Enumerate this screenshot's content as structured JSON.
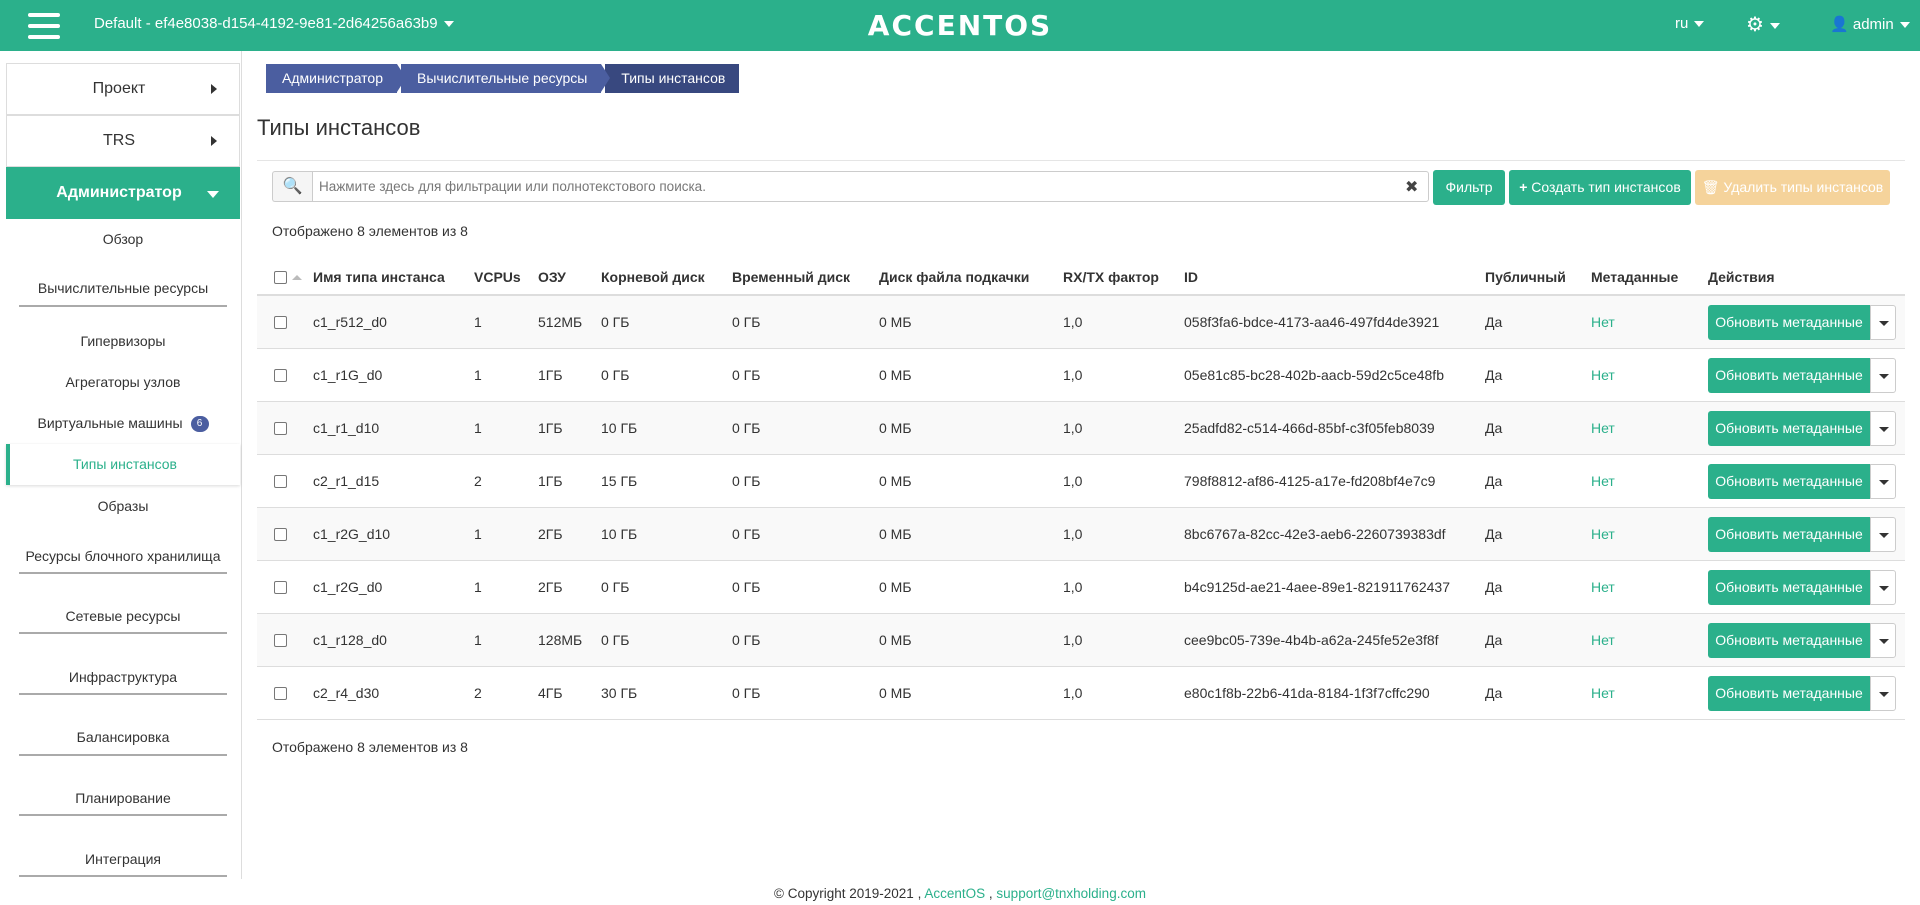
{
  "header": {
    "project": "Default - ef4e8038-d154-4192-9e81-2d64256a63b9",
    "logo": "ACCENTOS",
    "lang": "ru",
    "user": "admin"
  },
  "sidebar": {
    "project": "Проект",
    "trs": "TRS",
    "admin": "Администратор",
    "items": {
      "overview": "Обзор",
      "compute": "Вычислительные ресурсы",
      "hypervisors": "Гипервизоры",
      "aggregates": "Агрегаторы узлов",
      "vms": "Виртуальные машины",
      "vms_count": "6",
      "flavors": "Типы инстансов",
      "images": "Образы",
      "block": "Ресурсы блочного хранилища",
      "network": "Сетевые ресурсы",
      "infra": "Инфраструктура",
      "balancing": "Балансировка",
      "planning": "Планирование",
      "integration": "Интеграция"
    }
  },
  "breadcrumb": [
    "Администратор",
    "Вычислительные ресурсы",
    "Типы инстансов"
  ],
  "page_title": "Типы инстансов",
  "filter": {
    "placeholder": "Нажмите здесь для фильтрации или полнотекстового поиска.",
    "filter_btn": "Фильтр",
    "create_btn": "Создать тип инстансов",
    "delete_btn": "Удалить типы инстансов"
  },
  "count_text": "Отображено 8 элементов из 8",
  "table": {
    "headers": {
      "name": "Имя типа инстанса",
      "vcpus": "VCPUs",
      "ram": "ОЗУ",
      "root": "Корневой диск",
      "ephemeral": "Временный диск",
      "swap": "Диск файла подкачки",
      "rxtx": "RX/TX фактор",
      "id": "ID",
      "public": "Публичный",
      "metadata": "Метаданные",
      "actions": "Действия"
    },
    "action_label": "Обновить метаданные",
    "rows": [
      {
        "name": "c1_r512_d0",
        "vcpus": "1",
        "ram": "512МБ",
        "root": "0 ГБ",
        "ephemeral": "0 ГБ",
        "swap": "0 МБ",
        "rxtx": "1,0",
        "id": "058f3fa6-bdce-4173-aa46-497fd4de3921",
        "public": "Да",
        "metadata": "Нет"
      },
      {
        "name": "c1_r1G_d0",
        "vcpus": "1",
        "ram": "1ГБ",
        "root": "0 ГБ",
        "ephemeral": "0 ГБ",
        "swap": "0 МБ",
        "rxtx": "1,0",
        "id": "05e81c85-bc28-402b-aacb-59d2c5ce48fb",
        "public": "Да",
        "metadata": "Нет"
      },
      {
        "name": "c1_r1_d10",
        "vcpus": "1",
        "ram": "1ГБ",
        "root": "10 ГБ",
        "ephemeral": "0 ГБ",
        "swap": "0 МБ",
        "rxtx": "1,0",
        "id": "25adfd82-c514-466d-85bf-c3f05feb8039",
        "public": "Да",
        "metadata": "Нет"
      },
      {
        "name": "c2_r1_d15",
        "vcpus": "2",
        "ram": "1ГБ",
        "root": "15 ГБ",
        "ephemeral": "0 ГБ",
        "swap": "0 МБ",
        "rxtx": "1,0",
        "id": "798f8812-af86-4125-a17e-fd208bf4e7c9",
        "public": "Да",
        "metadata": "Нет"
      },
      {
        "name": "c1_r2G_d10",
        "vcpus": "1",
        "ram": "2ГБ",
        "root": "10 ГБ",
        "ephemeral": "0 ГБ",
        "swap": "0 МБ",
        "rxtx": "1,0",
        "id": "8bc6767a-82cc-42e3-aeb6-2260739383df",
        "public": "Да",
        "metadata": "Нет"
      },
      {
        "name": "c1_r2G_d0",
        "vcpus": "1",
        "ram": "2ГБ",
        "root": "0 ГБ",
        "ephemeral": "0 ГБ",
        "swap": "0 МБ",
        "rxtx": "1,0",
        "id": "b4c9125d-ae21-4aee-89e1-821911762437",
        "public": "Да",
        "metadata": "Нет"
      },
      {
        "name": "c1_r128_d0",
        "vcpus": "1",
        "ram": "128МБ",
        "root": "0 ГБ",
        "ephemeral": "0 ГБ",
        "swap": "0 МБ",
        "rxtx": "1,0",
        "id": "cee9bc05-739e-4b4b-a62a-245fe52e3f8f",
        "public": "Да",
        "metadata": "Нет"
      },
      {
        "name": "c2_r4_d30",
        "vcpus": "2",
        "ram": "4ГБ",
        "root": "30 ГБ",
        "ephemeral": "0 ГБ",
        "swap": "0 МБ",
        "rxtx": "1,0",
        "id": "e80c1f8b-22b6-41da-8184-1f3f7cffc290",
        "public": "Да",
        "metadata": "Нет"
      }
    ]
  },
  "footer": {
    "copyright": "© Copyright 2019-2021 ,",
    "brand": "AccentOS",
    "sep": ",",
    "email": "support@tnxholding.com"
  }
}
